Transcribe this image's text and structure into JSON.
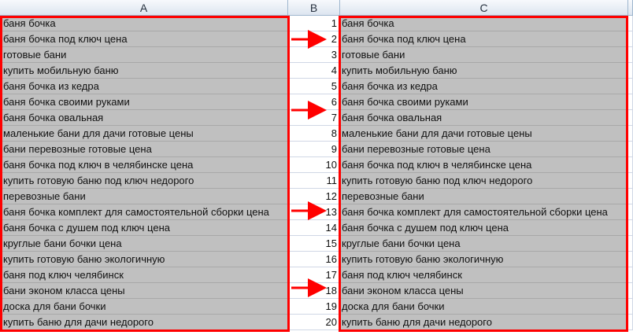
{
  "columns": {
    "a": "A",
    "b": "B",
    "c": "C"
  },
  "rows": [
    {
      "a": "баня бочка",
      "b": "1",
      "c": "баня бочка"
    },
    {
      "a": "баня бочка под ключ цена",
      "b": "2",
      "c": "баня бочка под ключ цена"
    },
    {
      "a": "готовые бани",
      "b": "3",
      "c": "готовые бани"
    },
    {
      "a": "купить мобильную баню",
      "b": "4",
      "c": "купить мобильную баню"
    },
    {
      "a": "баня бочка из кедра",
      "b": "5",
      "c": "баня бочка из кедра"
    },
    {
      "a": "баня бочка своими руками",
      "b": "6",
      "c": "баня бочка своими руками"
    },
    {
      "a": "баня бочка овальная",
      "b": "7",
      "c": "баня бочка овальная"
    },
    {
      "a": "маленькие бани для дачи готовые цены",
      "b": "8",
      "c": "маленькие бани для дачи готовые цены"
    },
    {
      "a": "бани перевозные готовые цена",
      "b": "9",
      "c": "бани перевозные готовые цена"
    },
    {
      "a": "баня бочка под ключ в челябинске цена",
      "b": "10",
      "c": "баня бочка под ключ в челябинске цена"
    },
    {
      "a": "купить готовую баню под ключ недорого",
      "b": "11",
      "c": "купить готовую баню под ключ недорого"
    },
    {
      "a": "перевозные бани",
      "b": "12",
      "c": "перевозные бани"
    },
    {
      "a": "баня бочка комплект для самостоятельной сборки цена",
      "b": "13",
      "c": "баня бочка комплект для самостоятельной сборки цена"
    },
    {
      "a": "баня бочка с душем под ключ цена",
      "b": "14",
      "c": "баня бочка с душем под ключ цена"
    },
    {
      "a": "круглые бани бочки цена",
      "b": "15",
      "c": "круглые бани бочки цена"
    },
    {
      "a": "купить готовую баню экологичную",
      "b": "16",
      "c": "купить готовую баню экологичную"
    },
    {
      "a": "баня под ключ челябинск",
      "b": "17",
      "c": "баня под ключ челябинск"
    },
    {
      "a": "бани эконом класса цены",
      "b": "18",
      "c": "бани эконом класса цены"
    },
    {
      "a": "доска для бани бочки",
      "b": "19",
      "c": "доска для бани бочки"
    },
    {
      "a": "купить баню для дачи недорого",
      "b": "20",
      "c": "купить баню для дачи недорого"
    }
  ],
  "highlight_color": "#ff0000"
}
